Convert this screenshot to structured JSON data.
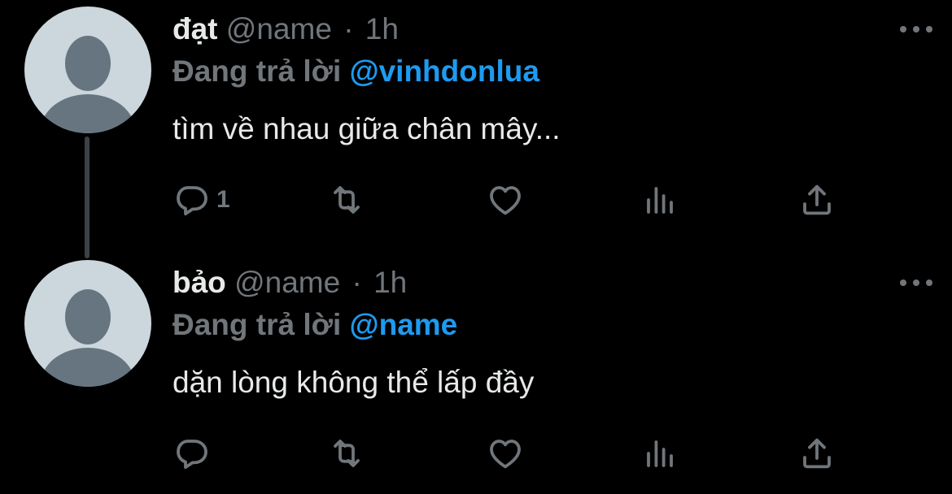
{
  "thread": {
    "tweets": [
      {
        "display_name": "đạt",
        "handle": "@name",
        "separator": "·",
        "time": "1h",
        "reply_prefix": "Đang trả lời",
        "reply_target": "@vinhdonlua",
        "text": "tìm về nhau giữa chân mây...",
        "reply_count": "1"
      },
      {
        "display_name": "bảo",
        "handle": "@name",
        "separator": "·",
        "time": "1h",
        "reply_prefix": "Đang trả lời",
        "reply_target": "@name",
        "text": "dặn lòng không thể lấp đầy",
        "reply_count": ""
      }
    ]
  },
  "icons": [
    "reply-icon",
    "retweet-icon",
    "like-icon",
    "views-icon",
    "share-icon",
    "more-icon",
    "avatar-icon"
  ],
  "colors": {
    "background": "#000000",
    "text": "#e7e9ea",
    "muted": "#71767b",
    "accent": "#1d9bf0",
    "avatar_bg": "#ccd6dd",
    "avatar_fg": "#66757f",
    "thread_line": "#3e4144"
  }
}
